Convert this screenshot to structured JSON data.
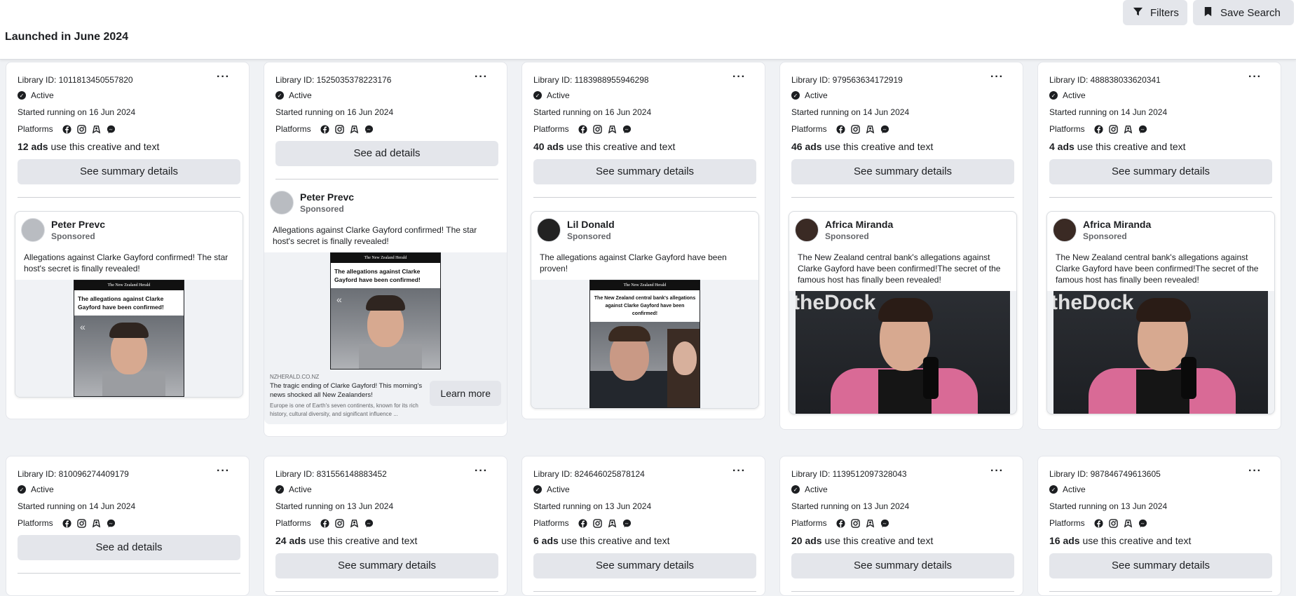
{
  "header": {
    "section_title": "Launched in June 2024",
    "filters_label": "Filters",
    "save_search_label": "Save Search"
  },
  "labels": {
    "active": "Active",
    "platforms": "Platforms",
    "ads_suffix": "use this creative and text",
    "see_summary": "See summary details",
    "see_ad_details": "See ad details",
    "sponsored": "Sponsored",
    "more": "..."
  },
  "cards": [
    {
      "library_id": "Library ID: 1011813450557820",
      "started": "Started running on 16 Jun 2024",
      "ads_count": "12 ads",
      "button": "See summary details",
      "advertiser": "Peter Prevc",
      "text": "Allegations against Clarke Gayford confirmed! The star host's secret is finally revealed!",
      "headline": "The allegations against Clarke Gayford have been confirmed!",
      "masthead": "The New Zealand Herald"
    },
    {
      "library_id": "Library ID: 1525035378223176",
      "started": "Started running on 16 Jun 2024",
      "ads_count": "",
      "button": "See ad details",
      "advertiser": "Peter Prevc",
      "text": "Allegations against Clarke Gayford confirmed! The star host's secret is finally revealed!",
      "headline": "The allegations against Clarke Gayford have been confirmed!",
      "masthead": "The New Zealand Herald",
      "link_domain": "NZHERALD.CO.NZ",
      "link_title": "The tragic ending of Clarke Gayford! This morning's news shocked all New Zealanders!",
      "link_desc": "Europe is one of Earth's seven continents, known for its rich history, cultural diversity, and significant influence ...",
      "cta": "Learn more"
    },
    {
      "library_id": "Library ID: 1183988955946298",
      "started": "Started running on 16 Jun 2024",
      "ads_count": "40 ads",
      "button": "See summary details",
      "advertiser": "Lil Donald",
      "text": "The allegations against Clarke Gayford have been proven!",
      "headline": "The New Zealand central bank's allegations against Clarke Gayford have been confirmed!",
      "masthead": "The New Zealand Herald"
    },
    {
      "library_id": "Library ID: 979563634172919",
      "started": "Started running on 14 Jun 2024",
      "ads_count": "46 ads",
      "button": "See summary details",
      "advertiser": "Africa Miranda",
      "text": "The New Zealand central bank's allegations against Clarke Gayford have been confirmed!The secret of the famous host has finally been revealed!",
      "banner": "theDock"
    },
    {
      "library_id": "Library ID: 488838033620341",
      "started": "Started running on 14 Jun 2024",
      "ads_count": "4 ads",
      "button": "See summary details",
      "advertiser": "Africa Miranda",
      "text": "The New Zealand central bank's allegations against Clarke Gayford have been confirmed!The secret of the famous host has finally been revealed!",
      "banner": "theDock"
    }
  ],
  "cards_row2": [
    {
      "library_id": "Library ID: 810096274409179",
      "started": "Started running on 14 Jun 2024",
      "ads_count": "",
      "button": "See ad details"
    },
    {
      "library_id": "Library ID: 831556148883452",
      "started": "Started running on 13 Jun 2024",
      "ads_count": "24 ads",
      "button": "See summary details"
    },
    {
      "library_id": "Library ID: 824646025878124",
      "started": "Started running on 13 Jun 2024",
      "ads_count": "6 ads",
      "button": "See summary details"
    },
    {
      "library_id": "Library ID: 1139512097328043",
      "started": "Started running on 13 Jun 2024",
      "ads_count": "20 ads",
      "button": "See summary details"
    },
    {
      "library_id": "Library ID: 987846749613605",
      "started": "Started running on 13 Jun 2024",
      "ads_count": "16 ads",
      "button": "See summary details"
    }
  ],
  "icons": [
    "filter-icon",
    "bookmark-icon",
    "check-circle-icon",
    "facebook-icon",
    "instagram-icon",
    "audience-network-icon",
    "messenger-icon",
    "more-icon"
  ]
}
